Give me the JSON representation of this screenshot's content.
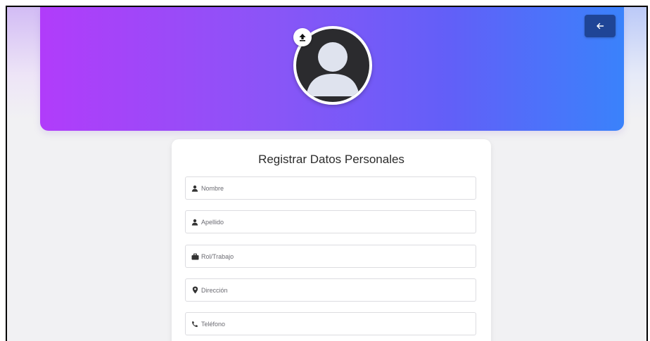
{
  "header": {
    "back_button_icon": "arrow-left-icon",
    "avatar_icon": "user-avatar-icon",
    "upload_icon": "upload-arrow-icon",
    "gradient": [
      "#b13cfa",
      "#625ff8",
      "#3a82fb"
    ],
    "back_button_color": "#1f4596"
  },
  "form": {
    "title": "Registrar Datos Personales",
    "fields": [
      {
        "placeholder": "Nombre",
        "icon": "person-icon"
      },
      {
        "placeholder": "Apellido",
        "icon": "person-icon"
      },
      {
        "placeholder": "Rol/Trabajo",
        "icon": "briefcase-icon"
      },
      {
        "placeholder": "Dirección",
        "icon": "map-marker-icon"
      },
      {
        "placeholder": "Teléfono",
        "icon": "phone-icon"
      }
    ]
  }
}
